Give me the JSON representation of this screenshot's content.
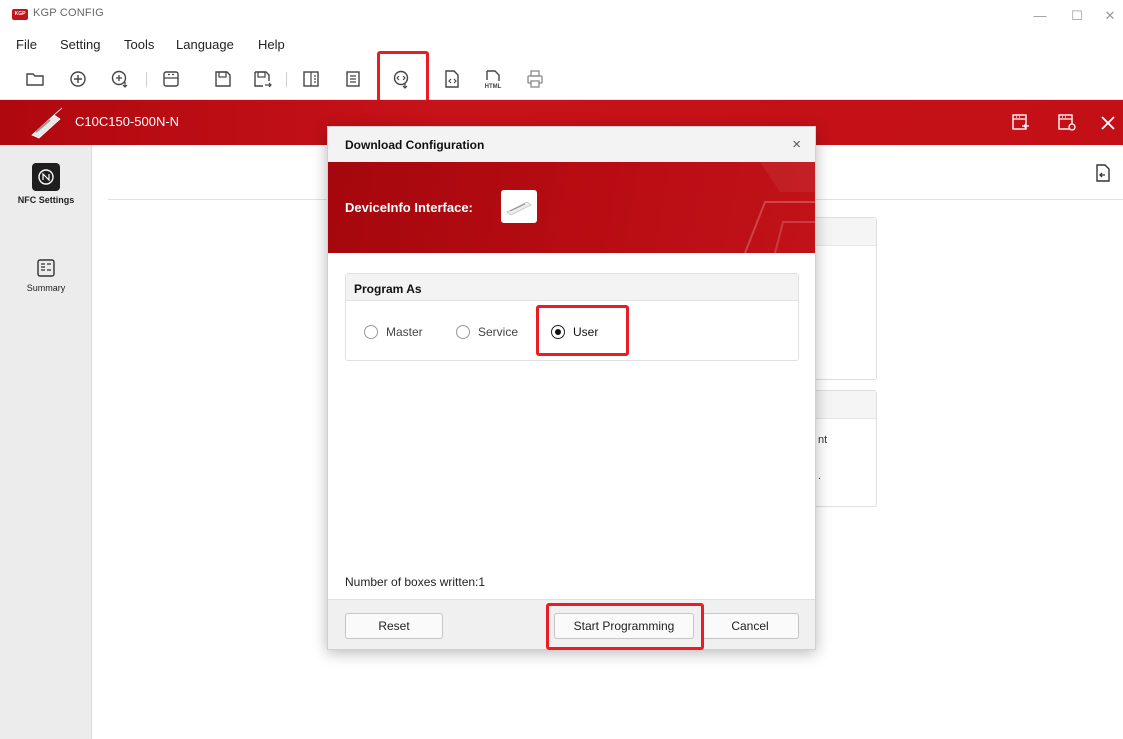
{
  "app": {
    "title": "KGP CONFIG",
    "logo_text": "KGP",
    "window_controls": {
      "minimize": "—",
      "maximize": "☐",
      "close": "✕"
    }
  },
  "menu": [
    "File",
    "Setting",
    "Tools",
    "Language",
    "Help"
  ],
  "toolbar": {
    "icons": [
      "folder-open-icon",
      "add-circle-icon",
      "add-upload-icon",
      "device-save-icon",
      "save-icon",
      "save-as-icon",
      "split-view-icon",
      "document-icon",
      "download-config-icon",
      "code-export-icon",
      "html-export-icon",
      "print-icon"
    ],
    "html_label": "HTML"
  },
  "header": {
    "device_name": "C10C150-500N-N"
  },
  "sidebar": {
    "items": [
      {
        "label": "NFC Settings",
        "icon": "nfc-icon"
      },
      {
        "label": "Summary",
        "icon": "summary-icon"
      }
    ]
  },
  "background": {
    "partial_text_1": "nt",
    "partial_text_2": "."
  },
  "dialog": {
    "title": "Download Configuration",
    "close": "×",
    "interface_label": "DeviceInfo Interface:",
    "group_title": "Program As",
    "options": [
      {
        "label": "Master",
        "checked": false
      },
      {
        "label": "Service",
        "checked": false
      },
      {
        "label": "User",
        "checked": true
      }
    ],
    "boxes_written": "Number of boxes written:1",
    "reset_label": "Reset",
    "start_label": "Start Programming",
    "cancel_label": "Cancel"
  },
  "colors": {
    "brand_red": "#c0161b",
    "highlight": "#ea1c24"
  }
}
